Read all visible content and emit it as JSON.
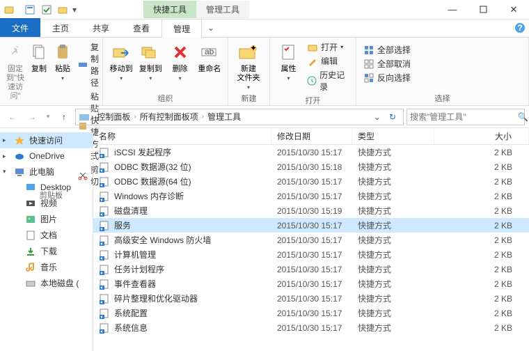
{
  "titlebar": {
    "context_tabs": [
      "快捷工具",
      "管理工具"
    ]
  },
  "tabs": {
    "file": "文件",
    "items": [
      "主页",
      "共享",
      "查看",
      "管理"
    ],
    "selected": 3
  },
  "ribbon": {
    "group_clipboard": "剪贴板",
    "group_organize": "组织",
    "group_new": "新建",
    "group_open": "打开",
    "group_select": "选择",
    "pin": "固定到\"快速访问\"",
    "copy": "复制",
    "paste": "粘贴",
    "copy_path": "复制路径",
    "paste_shortcut": "粘贴快捷方式",
    "cut": "剪切",
    "move": "移动到",
    "copy_to": "复制到",
    "delete": "删除",
    "rename": "重命名",
    "new_folder": "新建\n文件夹",
    "properties": "属性",
    "open": "打开",
    "edit": "编辑",
    "history": "历史记录",
    "select_all": "全部选择",
    "select_none": "全部取消",
    "invert": "反向选择"
  },
  "breadcrumb": [
    "控制面板",
    "所有控制面板项",
    "管理工具"
  ],
  "search_placeholder": "搜索\"管理工具\"",
  "columns": {
    "name": "名称",
    "date": "修改日期",
    "type": "类型",
    "size": "大小"
  },
  "nav": [
    {
      "label": "快速访问",
      "icon": "star",
      "sel": true
    },
    {
      "label": "OneDrive",
      "icon": "cloud"
    },
    {
      "label": "此电脑",
      "icon": "pc",
      "exp": true
    },
    {
      "label": "Desktop",
      "icon": "desktop",
      "indent": true
    },
    {
      "label": "视频",
      "icon": "video",
      "indent": true
    },
    {
      "label": "图片",
      "icon": "pic",
      "indent": true
    },
    {
      "label": "文档",
      "icon": "doc",
      "indent": true
    },
    {
      "label": "下载",
      "icon": "down",
      "indent": true
    },
    {
      "label": "音乐",
      "icon": "music",
      "indent": true
    },
    {
      "label": "本地磁盘 (",
      "icon": "disk",
      "indent": true
    }
  ],
  "rows": [
    {
      "name": "iSCSI 发起程序",
      "date": "2015/10/30 15:17",
      "type": "快捷方式",
      "size": "2 KB"
    },
    {
      "name": "ODBC 数据源(32 位)",
      "date": "2015/10/30 15:18",
      "type": "快捷方式",
      "size": "2 KB"
    },
    {
      "name": "ODBC 数据源(64 位)",
      "date": "2015/10/30 15:17",
      "type": "快捷方式",
      "size": "2 KB"
    },
    {
      "name": "Windows 内存诊断",
      "date": "2015/10/30 15:17",
      "type": "快捷方式",
      "size": "2 KB"
    },
    {
      "name": "磁盘清理",
      "date": "2015/10/30 15:19",
      "type": "快捷方式",
      "size": "2 KB"
    },
    {
      "name": "服务",
      "date": "2015/10/30 15:17",
      "type": "快捷方式",
      "size": "2 KB",
      "sel": true
    },
    {
      "name": "高级安全 Windows 防火墙",
      "date": "2015/10/30 15:17",
      "type": "快捷方式",
      "size": "2 KB"
    },
    {
      "name": "计算机管理",
      "date": "2015/10/30 15:17",
      "type": "快捷方式",
      "size": "2 KB"
    },
    {
      "name": "任务计划程序",
      "date": "2015/10/30 15:17",
      "type": "快捷方式",
      "size": "2 KB"
    },
    {
      "name": "事件查看器",
      "date": "2015/10/30 15:17",
      "type": "快捷方式",
      "size": "2 KB"
    },
    {
      "name": "碎片整理和优化驱动器",
      "date": "2015/10/30 15:17",
      "type": "快捷方式",
      "size": "2 KB"
    },
    {
      "name": "系统配置",
      "date": "2015/10/30 15:17",
      "type": "快捷方式",
      "size": "2 KB"
    },
    {
      "name": "系统信息",
      "date": "2015/10/30 15:17",
      "type": "快捷方式",
      "size": "2 KB"
    }
  ]
}
